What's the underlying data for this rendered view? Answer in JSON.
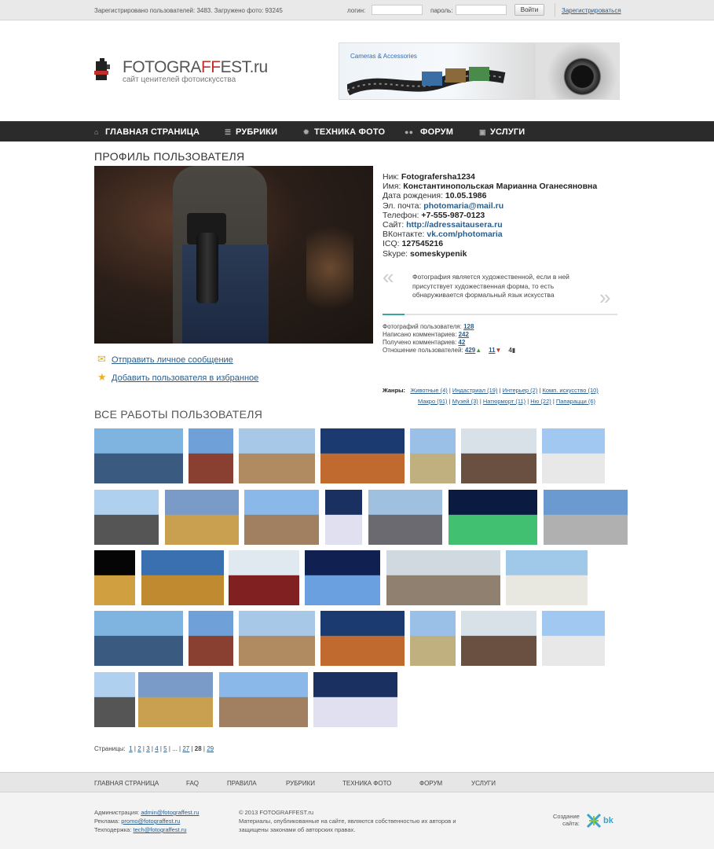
{
  "topbar": {
    "stats": "Зарегистрировано пользователей: 3483. Загружено фото: 93245",
    "login_label": "логин:",
    "password_label": "пароль:",
    "login_button": "Войти",
    "register_link": "Зарегистрироваться"
  },
  "logo": {
    "main_a": "FOTOGRA",
    "main_b": "FF",
    "main_c": "EST",
    "tld": ".ru",
    "subtitle": "сайт ценителей фотоискусства"
  },
  "banner": {
    "text": "Cameras & Accessories"
  },
  "nav": {
    "items": [
      {
        "label": "ГЛАВНАЯ СТРАНИЦА",
        "icon": "home-icon"
      },
      {
        "label": "РУБРИКИ",
        "icon": "list-icon"
      },
      {
        "label": "ТЕХНИКА ФОТО",
        "icon": "gear-icon"
      },
      {
        "label": "ФОРУМ",
        "icon": "users-icon"
      },
      {
        "label": "УСЛУГИ",
        "icon": "camera-icon"
      }
    ]
  },
  "profile": {
    "title": "ПРОФИЛЬ ПОЛЬЗОВАТЕЛЯ",
    "nick_label": "Ник:",
    "nick": "Fotografersha1234",
    "name_label": "Имя:",
    "name": "Константинопольская Марианна Оганесяновна",
    "birth_label": "Дата рождения:",
    "birth": "10.05.1986",
    "email_label": "Эл. почта:",
    "email": "photomaria@mail.ru",
    "phone_label": "Телефон:",
    "phone": "+7-555-987-0123",
    "site_label": "Сайт:",
    "site": "http://adressaitausera.ru",
    "vk_label": "ВКонтакте:",
    "vk": "vk.com/photomaria",
    "icq_label": "ICQ:",
    "icq": "127545216",
    "skype_label": "Skype:",
    "skype": "someskypenik",
    "quote": "Фотография является художественной, если в ней присутствует художественная форма, то есть обнаруживается формальный язык искусства",
    "quote_open": "«",
    "quote_close": "»",
    "photos_label": "Фотографий пользователя:",
    "photos": "128",
    "comments_written_label": "Написано комментариев:",
    "comments_written": "242",
    "comments_received_label": "Получено комментариев:",
    "comments_received": "42",
    "attitude_label": "Отношение пользователей:",
    "likes": "429",
    "dislikes": "11",
    "neutral": "4",
    "send_message": "Отправить личное сообщение",
    "add_favorite": "Добавить пользователя в избранное",
    "genres_label": "Жанры:",
    "genres_row1": [
      "Животные (4)",
      "Индастриал (19)",
      "Интерьер (2)",
      "Комп. искусство (10)"
    ],
    "genres_row2": [
      "Макро (91)",
      "Музей (3)",
      "Натюрморт (11)",
      "Ню (22)",
      "Папарацци (6)"
    ]
  },
  "works": {
    "title": "ВСЕ РАБОТЫ ПОЛЬЗОВАТЕЛЯ"
  },
  "pager": {
    "label": "Страницы:",
    "pages": [
      "1",
      "2",
      "3",
      "4",
      "5",
      "...",
      "27"
    ],
    "current": "28",
    "last": "29"
  },
  "footer_nav": [
    "ГЛАВНАЯ СТРАНИЦА",
    "FAQ",
    "ПРАВИЛА",
    "РУБРИКИ",
    "ТЕХНИКА ФОТО",
    "ФОРУМ",
    "УСЛУГИ"
  ],
  "footer": {
    "admin_label": "Администрация:",
    "admin": "admin@fotograffest.ru",
    "ads_label": "Реклама:",
    "ads": "promo@fotograffest.ru",
    "tech_label": "Техподержка:",
    "tech": "tech@fotograffest.ru",
    "copyright": "© 2013 FOTOGRAFFEST.ru",
    "disclaimer": "Материалы, опубликованные на сайте, являются собственностью их авторов и защищены законами об авторских правах.",
    "created_label_1": "Создание",
    "created_label_2": "сайта:",
    "creator": "bk"
  },
  "colors": {
    "accent": "#c0302a",
    "link": "#2a5d8a",
    "nav_bg": "#2b2b2b",
    "quote_bar": "#3aa5a0"
  }
}
